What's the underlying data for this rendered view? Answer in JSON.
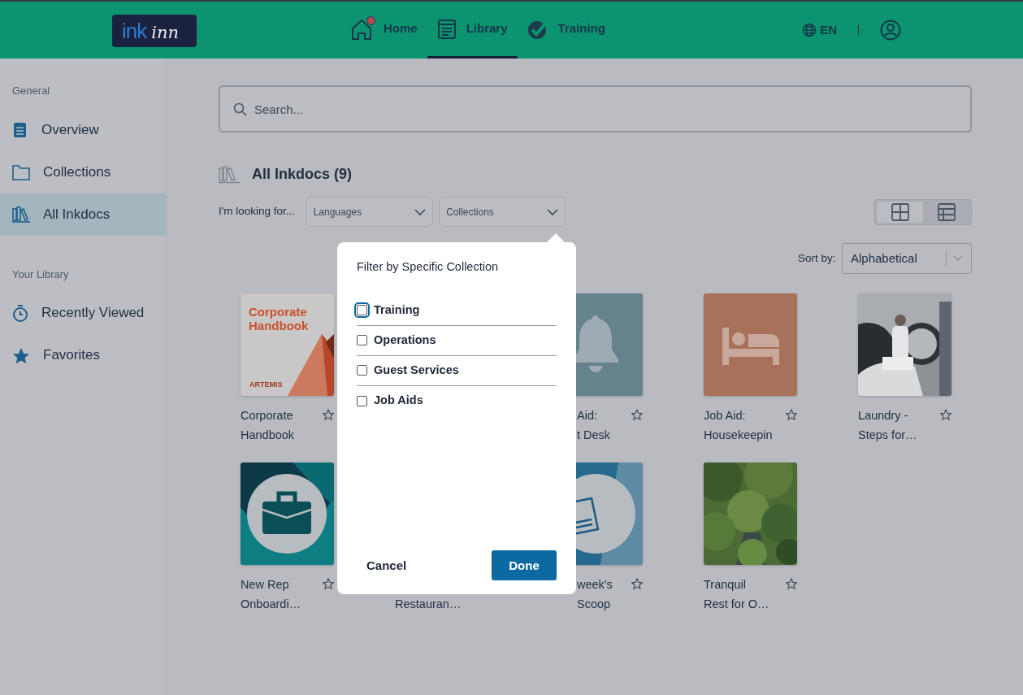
{
  "header": {
    "logo": {
      "part1": "ink",
      "part2": "inn"
    },
    "tabs": [
      {
        "label": "Home",
        "selected": false,
        "badge": true
      },
      {
        "label": "Library",
        "selected": true,
        "badge": false
      },
      {
        "label": "Training",
        "selected": false,
        "badge": false
      }
    ],
    "language": "EN"
  },
  "sidebar": {
    "sections": [
      {
        "heading": "General",
        "items": [
          {
            "label": "Overview",
            "selected": false
          },
          {
            "label": "Collections",
            "selected": false
          },
          {
            "label": "All Inkdocs",
            "selected": true
          }
        ]
      },
      {
        "heading": "Your Library",
        "items": [
          {
            "label": "Recently Viewed",
            "selected": false
          },
          {
            "label": "Favorites",
            "selected": false
          }
        ]
      }
    ]
  },
  "search": {
    "placeholder": "Search..."
  },
  "heading": "All Inkdocs (9)",
  "filters": {
    "label": "I'm looking for...",
    "dropdowns": [
      {
        "label": "Languages"
      },
      {
        "label": "Collections"
      }
    ]
  },
  "view_toggle": [
    {
      "kind": "grid",
      "selected": true
    },
    {
      "kind": "list",
      "selected": false
    }
  ],
  "sort": {
    "label": "Sort by:",
    "value": "Alphabetical"
  },
  "cards": [
    {
      "kind": "cover",
      "cover_title": "Corporate Handbook",
      "cover_brand": "ARTEMIS",
      "line_1": "Corporate",
      "line_2": "Handbook"
    },
    {
      "kind": "none"
    },
    {
      "kind": "bell",
      "line_1": "Aid:",
      "line_2": "t Desk",
      "clipped": true
    },
    {
      "kind": "bed",
      "line_1": "Job Aid:",
      "line_2": "Housekeepin"
    },
    {
      "kind": "picture",
      "line_1": "Laundry -",
      "line_2": "Steps for…"
    },
    {
      "kind": "briefcase",
      "line_1": "New Rep",
      "line_2": "Onboardi…"
    },
    {
      "kind": "none",
      "line_2": "Restauran…"
    },
    {
      "kind": "news",
      "line_1": "week's",
      "line_2": "Scoop",
      "clipped": true
    },
    {
      "kind": "picture",
      "line_1": "Tranquil",
      "line_2": "Rest for O…"
    }
  ],
  "popover": {
    "title": "Filter by Specific Collection",
    "options": [
      {
        "label": "Training",
        "checked": false,
        "focused": true
      },
      {
        "label": "Operations",
        "checked": false,
        "focused": false
      },
      {
        "label": "Guest Services",
        "checked": false,
        "focused": false
      },
      {
        "label": "Job Aids",
        "checked": false,
        "focused": false
      }
    ],
    "cancel": "Cancel",
    "done": "Done"
  }
}
